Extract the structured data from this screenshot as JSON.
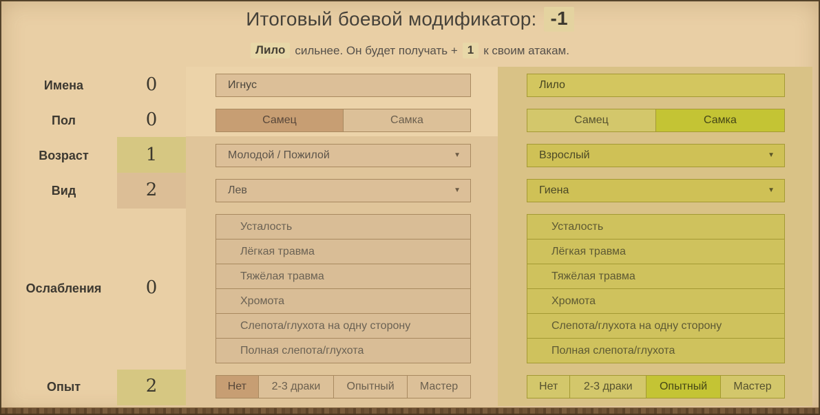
{
  "header": {
    "title": "Итоговый боевой модификатор:",
    "modifier_value": "-1"
  },
  "summary": {
    "winner_name": "Лило",
    "text_middle": "сильнее. Он будет получать +",
    "bonus_value": "1",
    "text_end": "к своим атакам."
  },
  "rows": [
    {
      "label": "Имена",
      "points": "0"
    },
    {
      "label": "Пол",
      "points": "0"
    },
    {
      "label": "Возраст",
      "points": "1"
    },
    {
      "label": "Вид",
      "points": "2"
    },
    {
      "label": "Ослабления",
      "points": "0"
    },
    {
      "label": "Опыт",
      "points": "2"
    }
  ],
  "icons": {
    "dropdown_arrow": "▼"
  },
  "characters": [
    {
      "name_value": "Игнус",
      "gender_options": [
        "Самец",
        "Самка"
      ],
      "gender_selected": "Самец",
      "age_selected": "Молодой / Пожилой",
      "species_selected": "Лев",
      "ailments": [
        "Усталость",
        "Лёгкая травма",
        "Тяжёлая травма",
        "Хромота",
        "Слепота/глухота на одну сторону",
        "Полная слепота/глухота"
      ],
      "experience_options": [
        "Нет",
        "2-3 драки",
        "Опытный",
        "Мастер"
      ],
      "experience_selected": "Нет",
      "theme_accent": "#c79e73"
    },
    {
      "name_value": "Лило",
      "gender_options": [
        "Самец",
        "Самка"
      ],
      "gender_selected": "Самка",
      "age_selected": "Взрослый",
      "species_selected": "Гиена",
      "ailments": [
        "Усталость",
        "Лёгкая травма",
        "Тяжёлая травма",
        "Хромота",
        "Слепота/глухота на одну сторону",
        "Полная слепота/глухота"
      ],
      "experience_options": [
        "Нет",
        "2-3 драки",
        "Опытный",
        "Мастер"
      ],
      "experience_selected": "Опытный",
      "theme_accent": "#c4c434"
    }
  ]
}
